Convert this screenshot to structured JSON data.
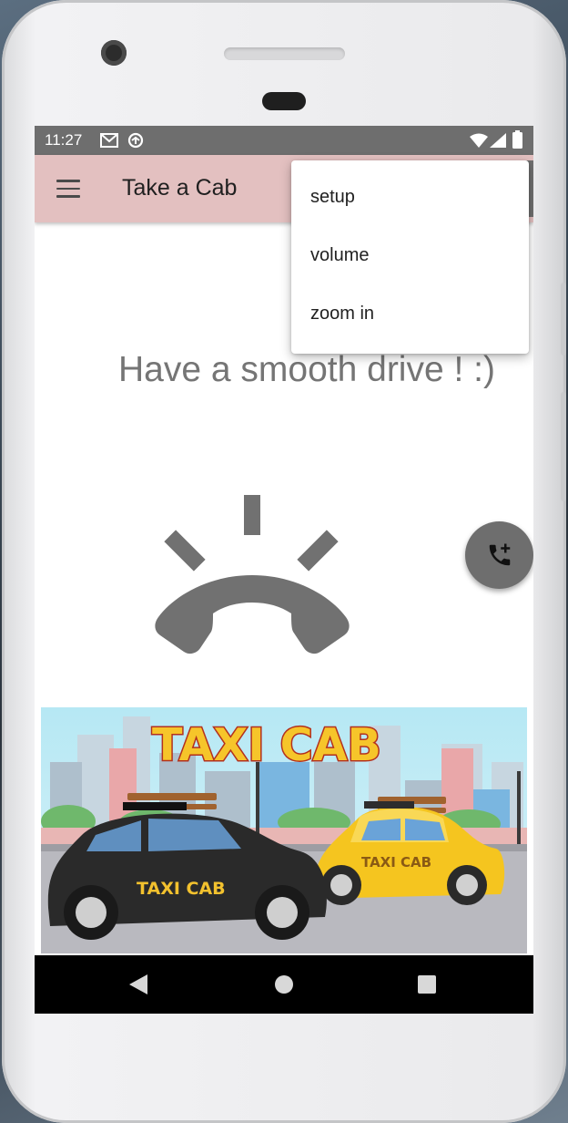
{
  "status_bar": {
    "time": "11:27",
    "left_icons": [
      "gmail-icon",
      "sync-icon"
    ],
    "right_icons": [
      "wifi-icon",
      "signal-icon",
      "battery-icon"
    ]
  },
  "app_bar": {
    "title": "Take a Cab",
    "background_color": "#e3c0c0"
  },
  "overflow_menu": {
    "items": [
      {
        "label": "setup"
      },
      {
        "label": "volume"
      },
      {
        "label": "zoom in"
      }
    ]
  },
  "main": {
    "message": "Have a smooth drive ! :)",
    "illustration_icon": "ringing-phone-icon"
  },
  "fab": {
    "icon": "add-call-icon",
    "color": "#6e6e6e"
  },
  "banner": {
    "heading": "TAXI CAB",
    "car_labels": [
      "TAXI CAB",
      "TAXI CAB"
    ]
  },
  "nav_bar": {
    "buttons": [
      "back-icon",
      "home-icon",
      "recents-icon"
    ]
  }
}
